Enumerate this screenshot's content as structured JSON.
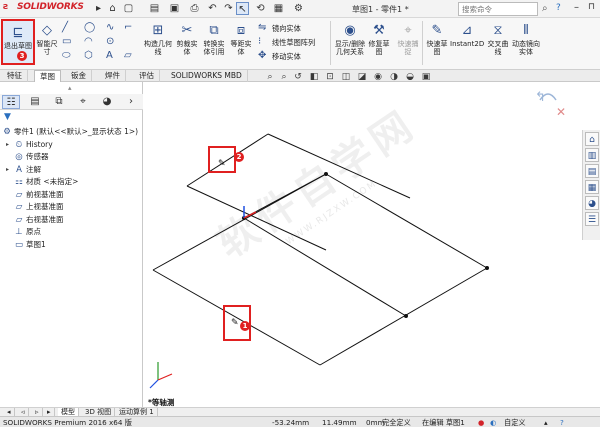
{
  "titlebar": {
    "logo": "SOLIDWORKS",
    "document_title": "草图1 - 零件1 *",
    "search_placeholder": "搜索命令"
  },
  "ribbon": {
    "exit_sketch": "退出草图",
    "smart_dimension": "智能尺寸",
    "solid_entity": "构造几何线",
    "trim": "剪裁实体",
    "convert": "转换实体引用",
    "offset": "等距实体",
    "mirror": "镜向实体",
    "linear_pattern": "线性草图阵列",
    "move": "移动实体",
    "display_relations": "显示/删除几何关系",
    "repair": "修复草图",
    "quick_snaps": "快速捕捉",
    "rapid_sketch": "快速草图",
    "instant2d": "Instant2D",
    "shaded_contours": "交叉曲线",
    "dynamic_mirror": "动态镜向实体"
  },
  "tabs": [
    "特征",
    "草图",
    "钣金",
    "焊件",
    "评估",
    "SOLIDWORKS MBD"
  ],
  "tree": {
    "root": "零件1 (默认<<默认>_显示状态 1>)",
    "items": [
      "History",
      "传感器",
      "注解",
      "材质 <未指定>",
      "前视基准面",
      "上视基准面",
      "右视基准面",
      "原点",
      "草图1"
    ]
  },
  "annotations": {
    "badge1": "1",
    "badge2": "2",
    "badge3": "3"
  },
  "watermark": {
    "main": "软件自学网",
    "sub": "WWW.RJZXW.COM"
  },
  "view": {
    "label": "*等轴测"
  },
  "bottom_tabs": [
    "模型",
    "3D 视图",
    "运动算例 1"
  ],
  "status": {
    "app": "SOLIDWORKS Premium 2016 x64 版",
    "x": "-53.24mm",
    "y": "11.49mm",
    "z": "0mm",
    "state": "完全定义",
    "editing": "在编辑 草图1",
    "units": "自定义"
  }
}
